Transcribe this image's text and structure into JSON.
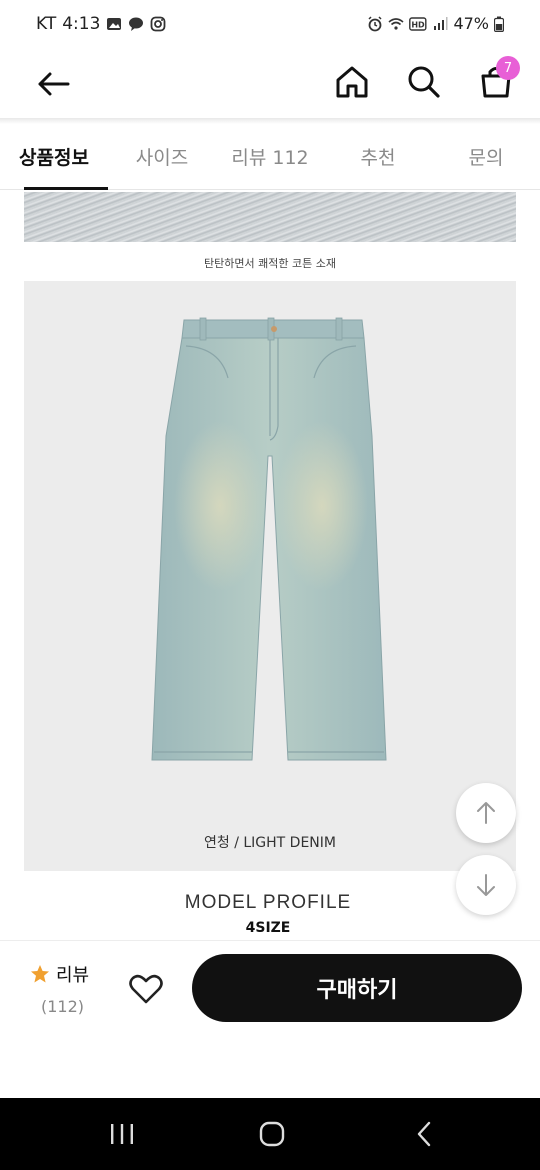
{
  "status_bar": {
    "carrier": "KT",
    "time": "4:13",
    "battery": "47%"
  },
  "header": {
    "cart_count": "7"
  },
  "tabs": [
    {
      "label": "상품정보",
      "active": true
    },
    {
      "label": "사이즈",
      "active": false
    },
    {
      "label": "리뷰 112",
      "active": false
    },
    {
      "label": "추천",
      "active": false
    },
    {
      "label": "문의",
      "active": false
    }
  ],
  "content": {
    "fabric_caption": "탄탄하면서 쾌적한 코튼 소재",
    "product_caption": "연청 /  LIGHT DENIM",
    "model_title": "MODEL PROFILE",
    "model_size": "4SIZE"
  },
  "bottom_bar": {
    "review_label": "리뷰",
    "review_count": "(112)",
    "buy_label": "구매하기"
  },
  "colors": {
    "accent_badge": "#e85fd6",
    "star": "#f0a030",
    "buy_button": "#111111",
    "denim": "#a9c3c4"
  }
}
